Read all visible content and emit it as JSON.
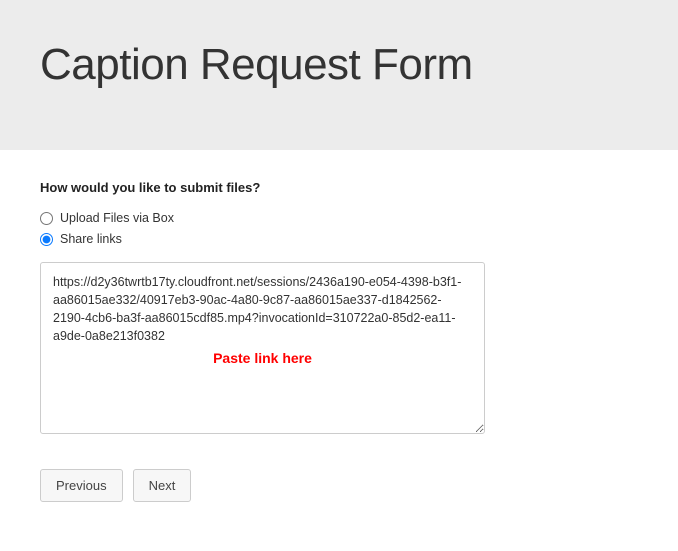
{
  "header": {
    "title": "Caption Request Form"
  },
  "form": {
    "question": "How would you like to submit files?",
    "options": {
      "upload": "Upload Files via Box",
      "share": "Share links"
    },
    "textarea_value": "https://d2y36twrtb17ty.cloudfront.net/sessions/2436a190-e054-4398-b3f1-aa86015ae332/40917eb3-90ac-4a80-9c87-aa86015ae337-d1842562-2190-4cb6-ba3f-aa86015cdf85.mp4?invocationId=310722a0-85d2-ea11-a9de-0a8e213f0382",
    "overlay_text": "Paste link here"
  },
  "buttons": {
    "previous": "Previous",
    "next": "Next"
  }
}
